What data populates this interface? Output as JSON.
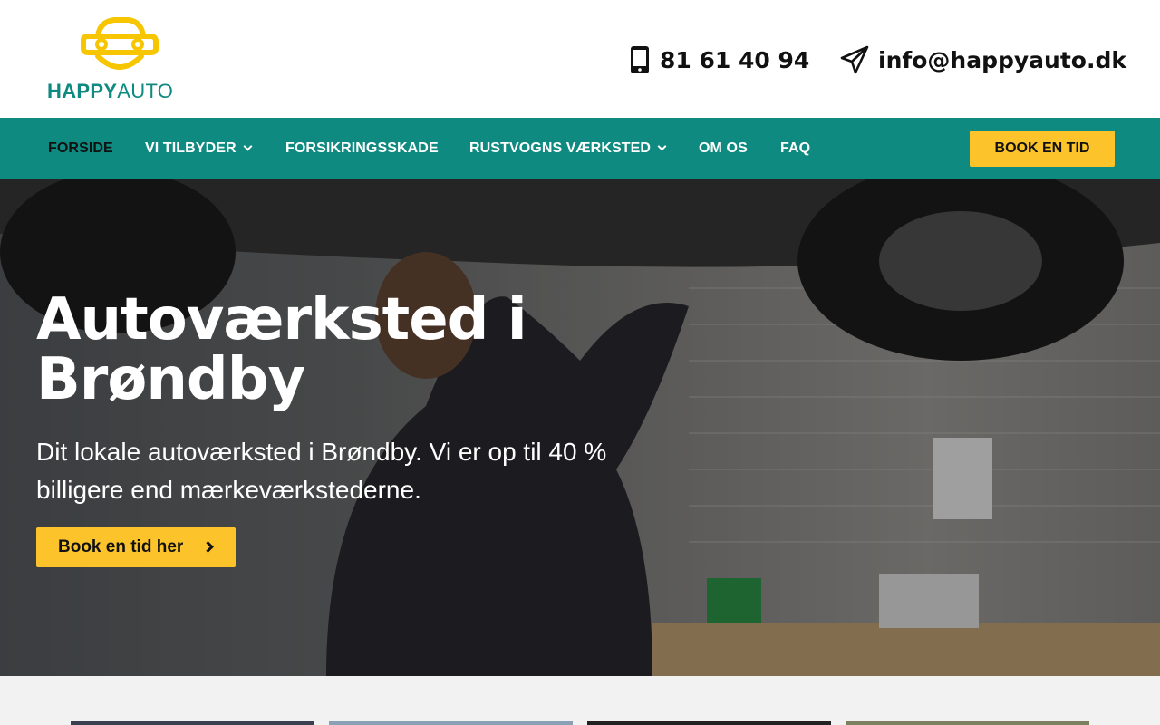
{
  "brand": {
    "logo_bold": "HAPPY",
    "logo_light": "AUTO",
    "icon": "car-face-logo"
  },
  "contact": {
    "phone": "81 61 40 94",
    "phone_icon": "smartphone-icon",
    "email": "info@happyauto.dk",
    "email_icon": "paper-plane-icon"
  },
  "nav": {
    "items": [
      {
        "label": "FORSIDE",
        "active": true
      },
      {
        "label": "VI TILBYDER",
        "dropdown": true
      },
      {
        "label": "FORSIKRINGSSKADE"
      },
      {
        "label": "RUSTVOGNS VÆRKSTED",
        "dropdown": true
      },
      {
        "label": "OM OS"
      },
      {
        "label": "FAQ"
      }
    ],
    "cta": "BOOK EN TID"
  },
  "hero": {
    "title": "Autoværksted i Brøndby",
    "subtitle": "Dit lokale autoværksted i Brøndby. Vi er op til 40 % billigere end mærkeværkstederne.",
    "cta": "Book en tid her"
  },
  "colors": {
    "teal": "#0f8a80",
    "yellow": "#fcc42a",
    "logo_yellow": "#f7c600"
  }
}
